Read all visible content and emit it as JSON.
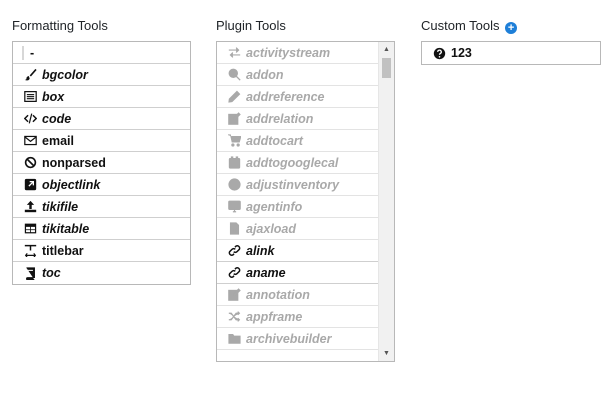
{
  "formatting": {
    "title": "Formatting Tools",
    "items": [
      {
        "label": "-",
        "icon": "separator-bar",
        "italic": false
      },
      {
        "label": "bgcolor",
        "icon": "paint-brush-icon",
        "italic": true
      },
      {
        "label": "box",
        "icon": "list-box-icon",
        "italic": true
      },
      {
        "label": "code",
        "icon": "code-icon",
        "italic": true
      },
      {
        "label": "email",
        "icon": "envelope-icon",
        "italic": false
      },
      {
        "label": "nonparsed",
        "icon": "ban-icon",
        "italic": false
      },
      {
        "label": "objectlink",
        "icon": "external-link-square-icon",
        "italic": true
      },
      {
        "label": "tikifile",
        "icon": "upload-icon",
        "italic": true
      },
      {
        "label": "tikitable",
        "icon": "table-icon",
        "italic": true
      },
      {
        "label": "titlebar",
        "icon": "text-height-icon",
        "italic": false
      },
      {
        "label": "toc",
        "icon": "book-icon",
        "italic": true
      }
    ]
  },
  "plugins": {
    "title": "Plugin Tools",
    "items": [
      {
        "label": "activitystream",
        "icon": "exchange-icon",
        "dim": true
      },
      {
        "label": "addon",
        "icon": "search-plus-icon",
        "dim": true
      },
      {
        "label": "addreference",
        "icon": "pencil-icon",
        "dim": true
      },
      {
        "label": "addrelation",
        "icon": "edit-icon",
        "dim": true
      },
      {
        "label": "addtocart",
        "icon": "cart-icon",
        "dim": true
      },
      {
        "label": "addtogooglecal",
        "icon": "calendar-icon",
        "dim": true
      },
      {
        "label": "adjustinventory",
        "icon": "plus-circle-icon",
        "dim": true
      },
      {
        "label": "agentinfo",
        "icon": "desktop-icon",
        "dim": true
      },
      {
        "label": "ajaxload",
        "icon": "file-code-icon",
        "dim": true
      },
      {
        "label": "alink",
        "icon": "link-icon",
        "dim": false
      },
      {
        "label": "aname",
        "icon": "link-icon",
        "dim": false
      },
      {
        "label": "annotation",
        "icon": "edit-icon",
        "dim": true
      },
      {
        "label": "appframe",
        "icon": "random-icon",
        "dim": true
      },
      {
        "label": "archivebuilder",
        "icon": "folder-icon",
        "dim": true
      }
    ]
  },
  "custom": {
    "title": "Custom Tools",
    "add_icon": "plus-circle-icon",
    "items": [
      {
        "label": "123",
        "icon": "question-circle-icon"
      }
    ]
  }
}
